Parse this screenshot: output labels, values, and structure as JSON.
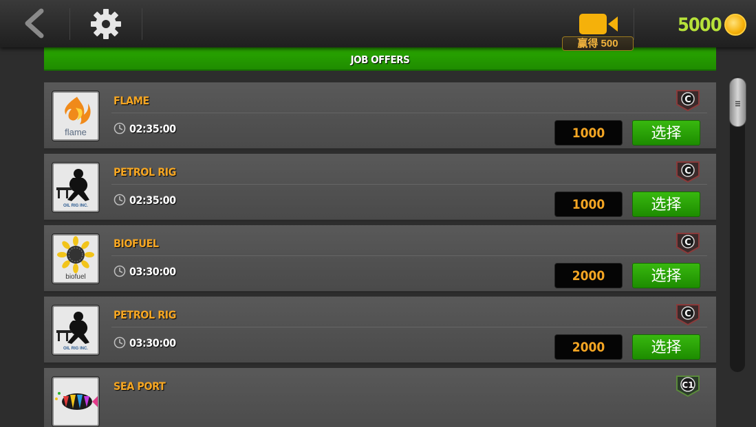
{
  "topbar": {
    "video_reward_label": "赢得 500",
    "coins": "5000"
  },
  "header": {
    "title": "JOB OFFERS"
  },
  "colors": {
    "accent_green": "#2aa800",
    "job_name": "#f5a623",
    "coin_text": "#b7e23a"
  },
  "jobs": [
    {
      "name": "FLAME",
      "time": "02:35:00",
      "reward": "1000",
      "button": "选择",
      "badge": "C",
      "logo": "flame-logo"
    },
    {
      "name": "PETROL RIG",
      "time": "02:35:00",
      "reward": "1000",
      "button": "选择",
      "badge": "C",
      "logo": "oil-rig-logo"
    },
    {
      "name": "BIOFUEL",
      "time": "03:30:00",
      "reward": "2000",
      "button": "选择",
      "badge": "C",
      "logo": "biofuel-logo"
    },
    {
      "name": "PETROL RIG",
      "time": "03:30:00",
      "reward": "2000",
      "button": "选择",
      "badge": "C",
      "logo": "oil-rig-logo"
    },
    {
      "name": "SEA PORT",
      "time": "",
      "reward": "",
      "button": "",
      "badge": "C1",
      "logo": "sea-port-logo"
    }
  ],
  "logo_text": {
    "flame": "flame",
    "biofuel": "biofuel",
    "oil_rig": "OIL RIG INC."
  }
}
